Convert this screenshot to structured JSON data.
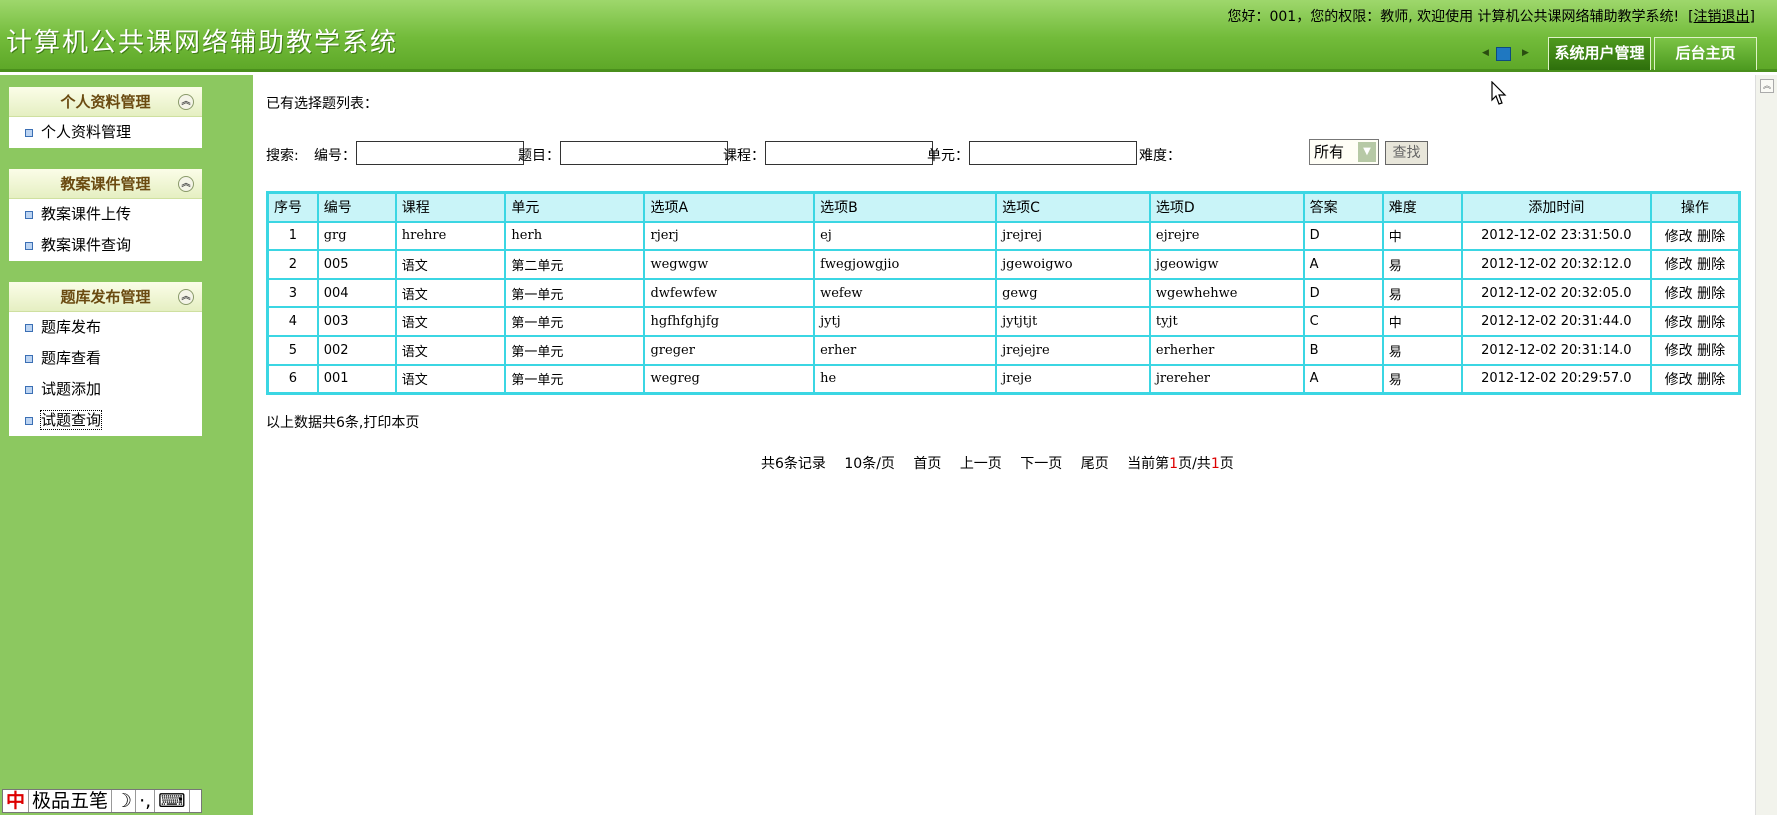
{
  "header": {
    "app_title": "计算机公共课网络辅助教学系统",
    "welcome_text": "您好：001，您的权限：教师, 欢迎使用 计算机公共课网络辅助教学系统!",
    "logout_open": "[",
    "logout_label": "注销退出",
    "logout_close": "]",
    "tabs": {
      "user_mgmt": "系统用户管理",
      "home": "后台主页"
    }
  },
  "sidebar": {
    "groups": [
      {
        "title": "个人资料管理",
        "items": [
          "个人资料管理"
        ]
      },
      {
        "title": "教案课件管理",
        "items": [
          "教案课件上传",
          "教案课件查询"
        ]
      },
      {
        "title": "题库发布管理",
        "items": [
          "题库发布",
          "题库查看",
          "试题添加",
          "试题查询"
        ]
      }
    ]
  },
  "ime": {
    "logo": "中",
    "name": "极品五笔",
    "moon": "☽",
    "punct": "·,",
    "kbd": "⌨"
  },
  "main": {
    "list_title": "已有选择题列表：",
    "search": {
      "search_label": "搜索:",
      "id_label": "编号：",
      "id_value": "",
      "question_label": "题目：",
      "question_value": "",
      "course_label": "课程：",
      "course_value": "",
      "unit_label": "单元：",
      "unit_value": "",
      "difficulty_label": "难度：",
      "difficulty_selected": "所有",
      "search_button": "查找"
    },
    "table": {
      "headers": [
        "序号",
        "编号",
        "课程",
        "单元",
        "选项A",
        "选项B",
        "选项C",
        "选项D",
        "答案",
        "难度",
        "添加时间",
        "操作"
      ],
      "rows": [
        [
          "1",
          "grg",
          "hrehre",
          "herh",
          "rjerj",
          "ej",
          "jrejrej",
          "ejrejre",
          "D",
          "中",
          "2012-12-02 23:31:50.0"
        ],
        [
          "2",
          "005",
          "语文",
          "第二单元",
          "wegwgw",
          "fwegjowgjio",
          "jgewoigwo",
          "jgeowigw",
          "A",
          "易",
          "2012-12-02 20:32:12.0"
        ],
        [
          "3",
          "004",
          "语文",
          "第一单元",
          "dwfewfew",
          "wefew",
          "gewg",
          "wgewhehwe",
          "D",
          "易",
          "2012-12-02 20:32:05.0"
        ],
        [
          "4",
          "003",
          "语文",
          "第一单元",
          "hgfhfghjfg",
          "jytj",
          "jytjtjt",
          "tyjt",
          "C",
          "中",
          "2012-12-02 20:31:44.0"
        ],
        [
          "5",
          "002",
          "语文",
          "第一单元",
          "greger",
          "erher",
          "jrejejre",
          "erherher",
          "B",
          "易",
          "2012-12-02 20:31:14.0"
        ],
        [
          "6",
          "001",
          "语文",
          "第一单元",
          "wegreg",
          "he",
          "jreje",
          "jrereher",
          "A",
          "易",
          "2012-12-02 20:29:57.0"
        ]
      ],
      "edit_label": "修改",
      "delete_label": "删除"
    },
    "summary": "以上数据共6条,打印本页",
    "pager": {
      "total": "共6条记录",
      "per_page": "10条/页",
      "first": "首页",
      "prev": "上一页",
      "next": "下一页",
      "last": "尾页",
      "current_prefix": "当前第",
      "current_page": "1",
      "mid": "页/共",
      "total_pages": "1",
      "suffix": "页"
    }
  }
}
